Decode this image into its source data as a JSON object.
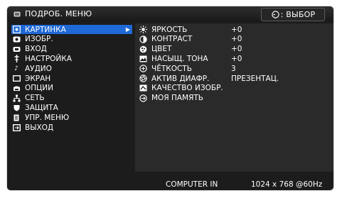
{
  "header": {
    "title": "ПОДРОБ. МЕНЮ",
    "hint_label": ": ВЫБОР"
  },
  "sidebar": {
    "items": [
      {
        "label": "КАРТИНКА",
        "icon": "picture-icon",
        "selected": true
      },
      {
        "label": "ИЗОБР.",
        "icon": "image-icon"
      },
      {
        "label": "ВХОД",
        "icon": "input-icon"
      },
      {
        "label": "НАСТРОЙКА",
        "icon": "setup-icon"
      },
      {
        "label": "АУДИО",
        "icon": "audio-icon"
      },
      {
        "label": "ЭКРАН",
        "icon": "screen-icon"
      },
      {
        "label": "ОПЦИИ",
        "icon": "options-icon"
      },
      {
        "label": "СЕТЬ",
        "icon": "network-icon"
      },
      {
        "label": "ЗАЩИТА",
        "icon": "security-icon"
      },
      {
        "label": "УПР. МЕНЮ",
        "icon": "menu-control-icon"
      },
      {
        "label": "ВЫХОД",
        "icon": "exit-icon"
      }
    ]
  },
  "panel": {
    "items": [
      {
        "label": "ЯРКОСТЬ",
        "value": "+0",
        "icon": "brightness-icon"
      },
      {
        "label": "КОНТРАСТ",
        "value": "+0",
        "icon": "contrast-icon"
      },
      {
        "label": "ЦВЕТ",
        "value": "+0",
        "icon": "color-icon"
      },
      {
        "label": "НАСЫЩ. ТОНА",
        "value": "+0",
        "icon": "tint-icon"
      },
      {
        "label": "ЧЁТКОСТЬ",
        "value": "3",
        "icon": "sharpness-icon"
      },
      {
        "label": "АКТИВ ДИАФР.",
        "value": "ПРЕЗЕНТАЦ.",
        "icon": "active-iris-icon"
      },
      {
        "label": "КАЧЕСТВО ИЗОБР.",
        "value": "",
        "icon": "image-quality-icon"
      },
      {
        "label": "МОЯ ПАМЯТЬ",
        "value": "",
        "icon": "my-memory-icon"
      }
    ]
  },
  "footer": {
    "source": "COMPUTER IN",
    "resolution": "1024 x 768 @60Hz"
  },
  "colors": {
    "selection": "#1f69d6",
    "background": "#1c1c1c",
    "panel": "#2a2a2a",
    "text": "#ffffff"
  }
}
